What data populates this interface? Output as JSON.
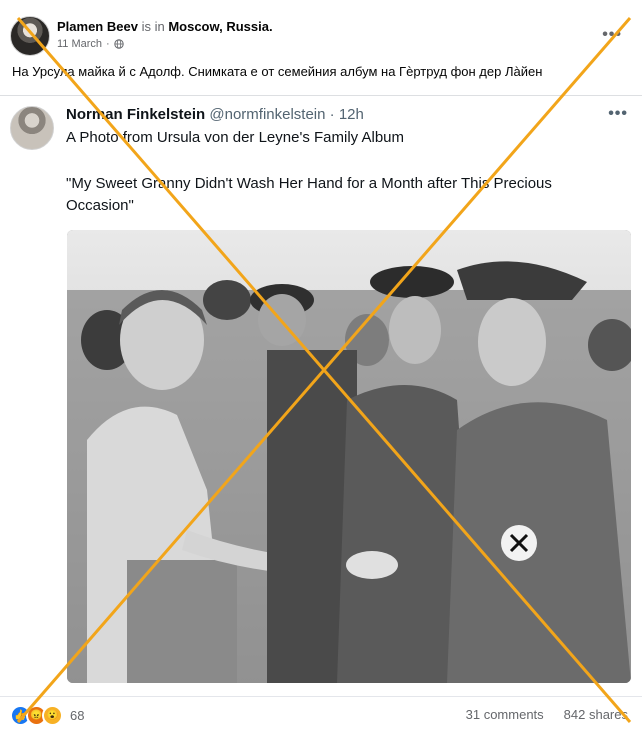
{
  "post": {
    "author": "Plamen Beev",
    "location_prefix": "is in",
    "location": "Moscow, Russia.",
    "date": "11 March",
    "text": "На Урсула майка й с Адолф. Снимката е от семейния албум на Гѐртруд фон дер Лàйен",
    "more_label": "•••"
  },
  "embed": {
    "name": "Norman Finkelstein",
    "handle": "@normfinkelstein",
    "separator": "·",
    "time": "12h",
    "line1": "A Photo from Ursula von der Leyne's Family Album",
    "line2": "\"My Sweet Granny Didn't Wash Her Hand for a Month after This Precious",
    "line3": "Occasion\"",
    "more_label": "•••"
  },
  "footer": {
    "reaction_count": "68",
    "comments": "31 comments",
    "shares": "842 shares"
  },
  "icons": {
    "globe": "globe-icon",
    "like": "like-reaction-icon",
    "angry": "angry-reaction-icon",
    "wow": "wow-reaction-icon"
  },
  "colors": {
    "cross": "#f2a51a",
    "link_muted": "#65676b",
    "like_blue": "#1877f2"
  }
}
